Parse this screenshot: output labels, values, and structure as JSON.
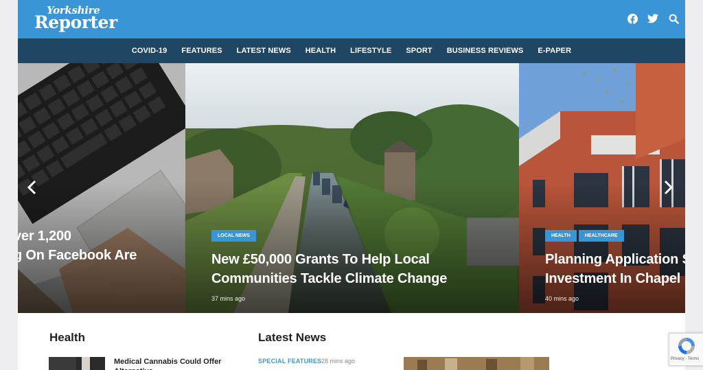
{
  "brand": {
    "line1": "Yorkshire",
    "line2": "Reporter"
  },
  "social": {
    "facebook": "facebook-icon",
    "twitter": "twitter-icon",
    "search": "search-icon"
  },
  "nav": {
    "items": [
      "COVID-19",
      "FEATURES",
      "LATEST NEWS",
      "HEALTH",
      "LIFESTYLE",
      "SPORT",
      "BUSINESS REVIEWS",
      "E-PAPER"
    ]
  },
  "slides": [
    {
      "headline_line1": "ver 1,200",
      "headline_line2": "g On Facebook Are"
    },
    {
      "tag": "LOCAL NEWS",
      "headline_line1": "New £50,000 Grants To Help Local",
      "headline_line2": "Communities Tackle Climate Change",
      "time": "37 mins ago"
    },
    {
      "tags": [
        "HEALTH",
        "HEALTHCARE"
      ],
      "headline_line1": "Planning Application S",
      "headline_line2": "Investment In Chapel",
      "time": "40 mins ago"
    }
  ],
  "sections": {
    "health": {
      "title": "Health",
      "article_title": "Medical Cannabis Could Offer Alternative"
    },
    "latest": {
      "title": "Latest News",
      "category": "SPECIAL FEATURES",
      "time": "28 mins ago"
    }
  },
  "recaptcha": {
    "text": "Privacy - Terms"
  },
  "colors": {
    "header": "#3a95d6",
    "nav": "#1f4763",
    "accent": "#3a95d6"
  }
}
